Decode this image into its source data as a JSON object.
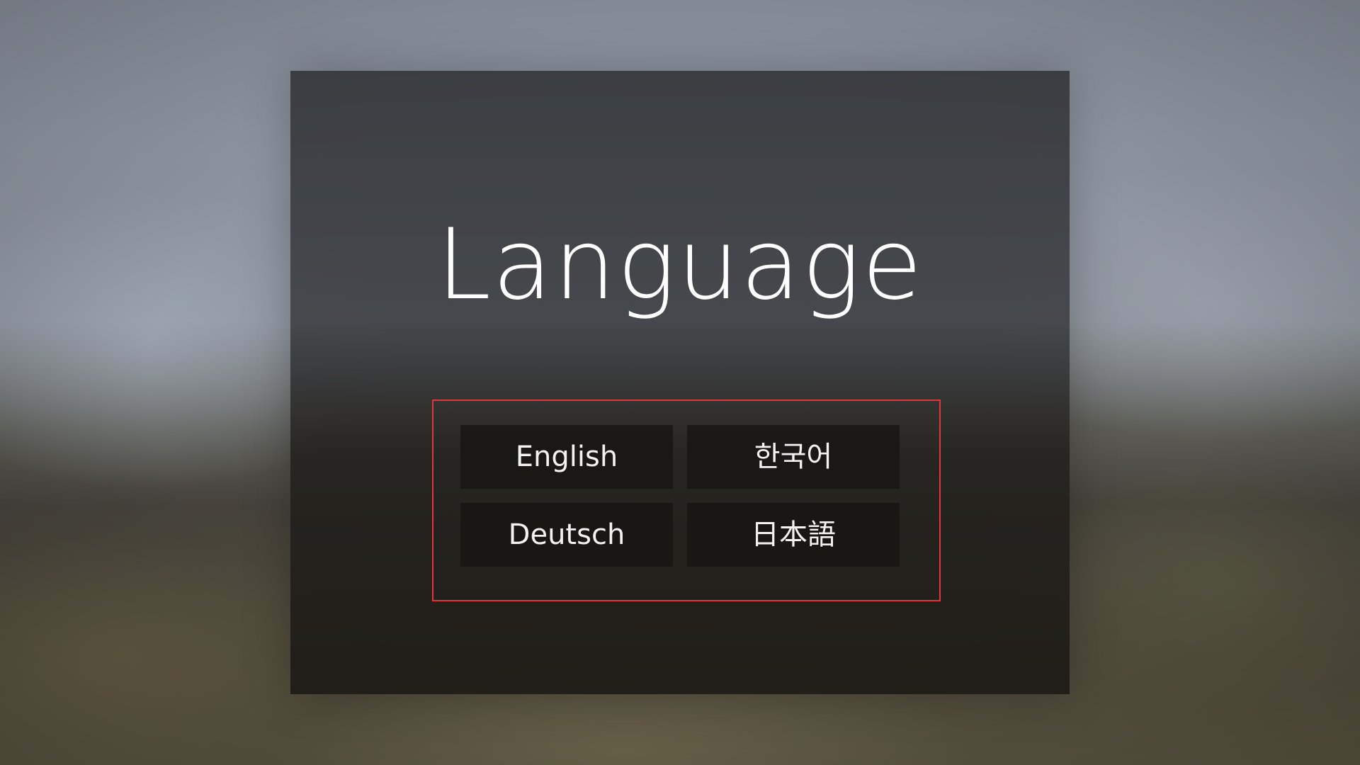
{
  "dialog": {
    "title": "Language",
    "highlight_color": "#e0363c",
    "options": [
      {
        "label": "English"
      },
      {
        "label": "한국어"
      },
      {
        "label": "Deutsch"
      },
      {
        "label": "日本語"
      }
    ]
  }
}
